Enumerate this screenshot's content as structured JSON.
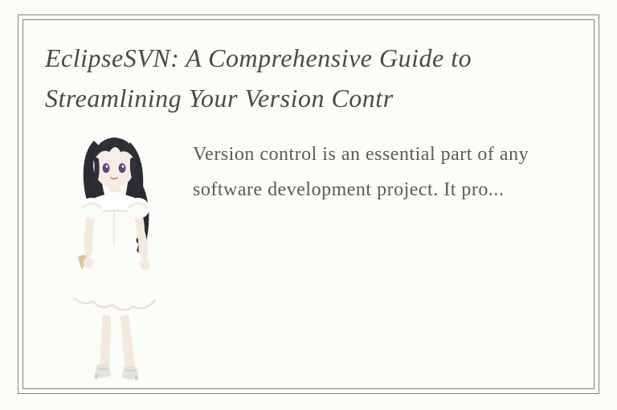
{
  "card": {
    "title": "EclipseSVN: A Comprehensive Guide to Streamlining Your Version Contr",
    "body": "Version control is an essential part of any software development project. It pro...",
    "illustration_name": "anime-girl-white-dress"
  }
}
